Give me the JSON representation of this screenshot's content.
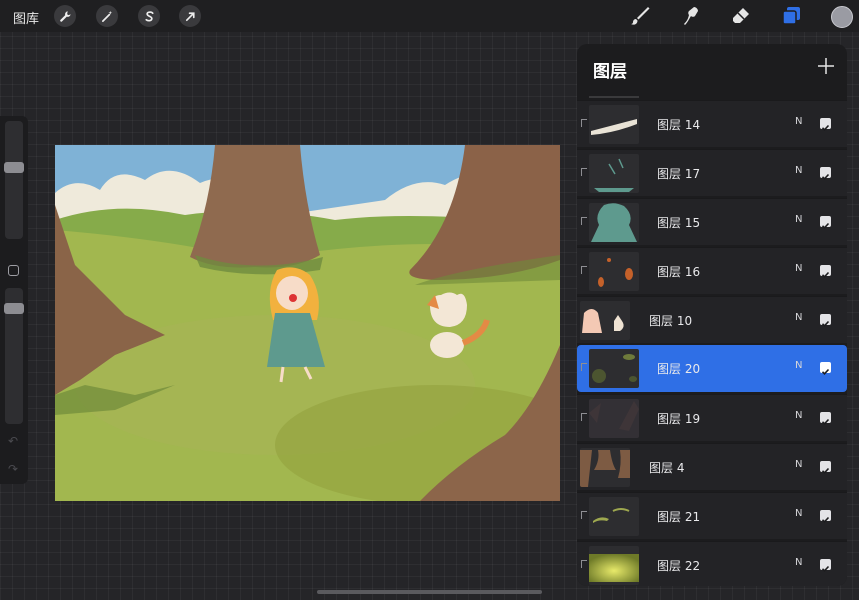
{
  "app": {
    "gallery_label": "图库",
    "left_tools": [
      "wrench-icon",
      "magic-wand-icon",
      "selection-icon",
      "transform-arrow-icon"
    ],
    "right_tools": [
      "brush-icon",
      "smudge-icon",
      "eraser-icon",
      "layers-icon"
    ],
    "current_color": "#9a9ba3",
    "accent": "#2f6fe6"
  },
  "layers_panel": {
    "title": "图层",
    "add_icon": "plus-icon",
    "layers": [
      {
        "name": "图层 14",
        "blend": "N",
        "visible": true,
        "clipped": true,
        "active": false
      },
      {
        "name": "图层 17",
        "blend": "N",
        "visible": true,
        "clipped": true,
        "active": false
      },
      {
        "name": "图层 15",
        "blend": "N",
        "visible": true,
        "clipped": true,
        "active": false
      },
      {
        "name": "图层 16",
        "blend": "N",
        "visible": true,
        "clipped": true,
        "active": false
      },
      {
        "name": "图层 10",
        "blend": "N",
        "visible": true,
        "clipped": false,
        "active": false
      },
      {
        "name": "图层 20",
        "blend": "N",
        "visible": true,
        "clipped": true,
        "active": true
      },
      {
        "name": "图层 19",
        "blend": "N",
        "visible": true,
        "clipped": true,
        "active": false
      },
      {
        "name": "图层 4",
        "blend": "N",
        "visible": true,
        "clipped": false,
        "active": false
      },
      {
        "name": "图层 21",
        "blend": "N",
        "visible": true,
        "clipped": true,
        "active": false
      },
      {
        "name": "图层 22",
        "blend": "N",
        "visible": true,
        "clipped": true,
        "active": false
      }
    ]
  }
}
